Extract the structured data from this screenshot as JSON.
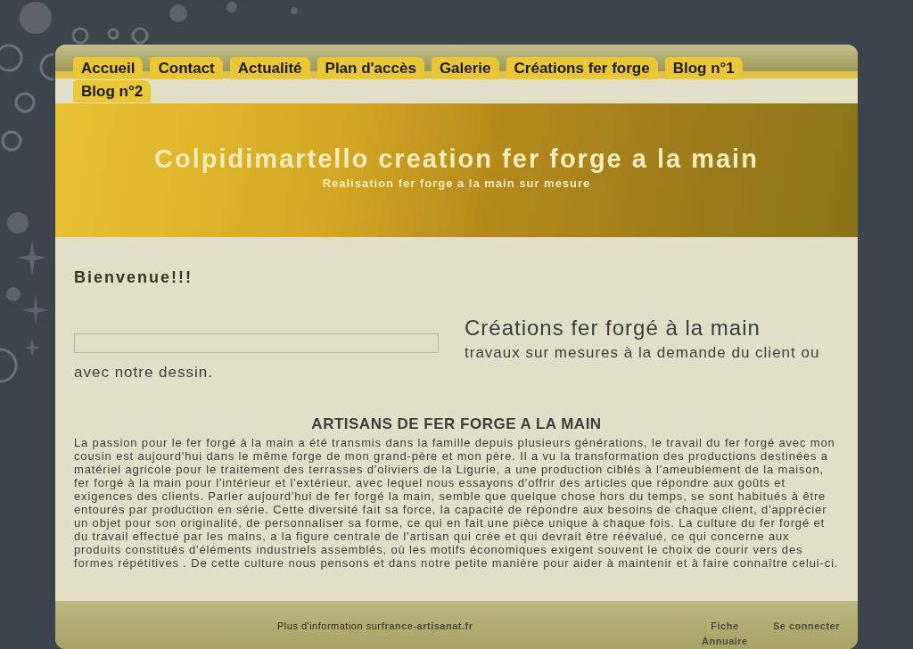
{
  "nav": {
    "tabs": [
      {
        "label": "Accueil"
      },
      {
        "label": "Contact"
      },
      {
        "label": "Actualité"
      },
      {
        "label": "Plan d'accès"
      },
      {
        "label": "Galerie"
      },
      {
        "label": "Créations fer forge"
      },
      {
        "label": "Blog n°1"
      },
      {
        "label": "Blog n°2"
      }
    ]
  },
  "banner": {
    "title": "Colpidimartello creation fer forge a la main",
    "subtitle": "Realisation fer forge a la main sur mesure"
  },
  "content": {
    "welcome": "Bienvenue!!!",
    "feature_title": "Créations fer forgé à la main",
    "feature_text": "travaux sur mesures à la demande du client ou avec notre dessin.",
    "section_title": "ARTISANS DE FER FORGE A LA MAIN",
    "body": "La passion pour le fer forgé à la main a été transmis dans la famille depuis plusieurs générations, le travail du fer forgé avec mon cousin est aujourd'hui dans le même forge de mon grand-père et mon père. Il a vu la transformation des productions destinées a matériel agricole pour le traitement des terrasses d'oliviers de la Ligurie, a une production ciblés à l'ameublement de la maison, fer forgé à la main pour l'intérieur et l'extérieur, avec lequel nous essayons d'offrir des articles que répondre aux goûts et exigences des clients. Parler aujourd'hui de fer forgé la main, semble que quelque chose hors du temps, se sont habitués à être entourés par production en série. Cette diversité fait sa force, la capacité de répondre aux besoins de chaque client, d'apprécier un objet pour son originalité, de personnaliser sa forme, ce qui en fait une pièce unique à chaque fois. La culture du fer forgé et du travail effectué par les mains, a la figure centrale de l'artisan qui crée et qui devrait être réévalué, ce qui concerne aux produits constitués d'éléments industriels assemblés, où les motifs économiques exigent souvent le choix de courir vers des formes répétitives . De cette culture nous pensons et dans notre petite manière pour aider à maintenir et à faire connaître celui-ci."
  },
  "footer": {
    "info_text": "Plus d'information sur",
    "info_link": "france-artisanat.fr",
    "links": [
      "Fiche Annuaire",
      "Se connecter"
    ]
  }
}
